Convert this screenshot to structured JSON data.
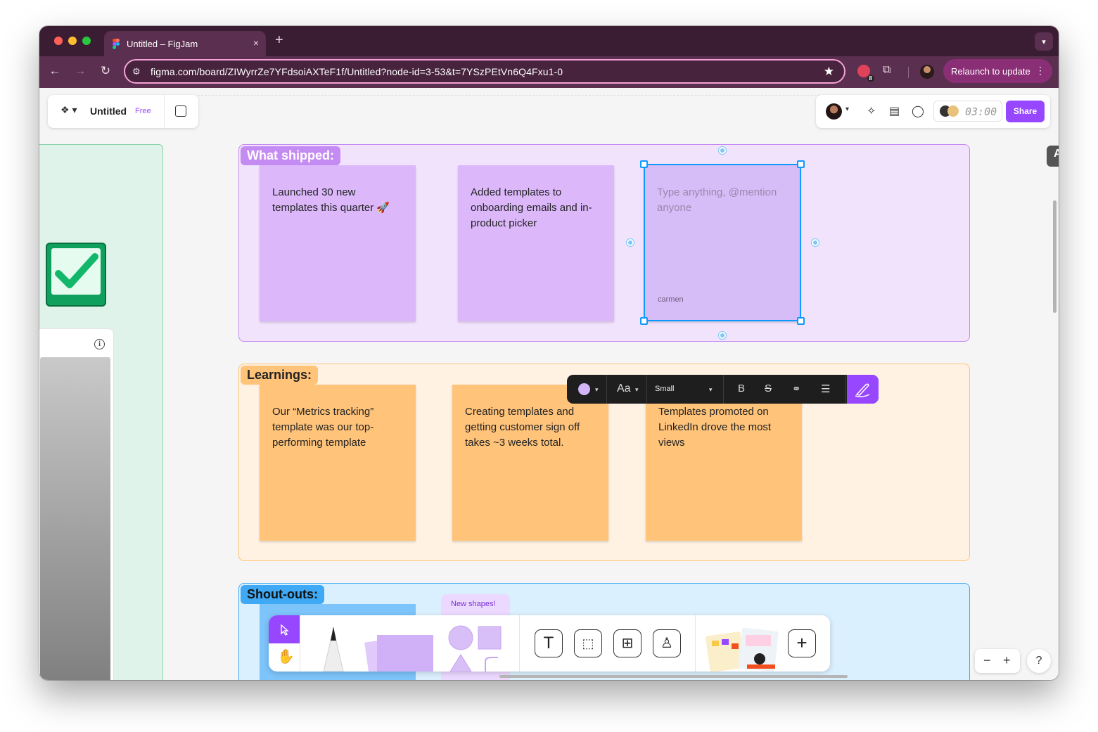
{
  "browser": {
    "tab_title": "Untitled – FigJam",
    "url": "figma.com/board/ZIWyrrZe7YFdsoiAXTeF1f/Untitled?node-id=3-53&t=7YSzPEtVn6Q4Fxu1-0",
    "extension_badge": "8",
    "relaunch_label": "Relaunch to update",
    "new_tab": "+",
    "close_tab": "×"
  },
  "file": {
    "name": "Untitled",
    "plan_badge": "Free"
  },
  "header": {
    "timer": "03:00",
    "share_label": "Share"
  },
  "sections": [
    {
      "label": "What shipped:",
      "notes": [
        {
          "text": "Launched 30 new templates this quarter 🚀"
        },
        {
          "text": "Added templates to onboarding emails and in-product picker"
        }
      ],
      "selected_note": {
        "placeholder": "Type anything, @mention anyone",
        "author": "carmen"
      }
    },
    {
      "label": "Learnings:",
      "notes": [
        {
          "text": "Our “Metrics tracking” template was our top-performing template"
        },
        {
          "text": "Creating templates and getting customer sign off takes ~3 weeks total."
        },
        {
          "text": "Templates promoted on LinkedIn drove the most views"
        }
      ]
    },
    {
      "label": "Shout-outs:",
      "notes": []
    }
  ],
  "context_toolbar": {
    "font_icon": "Aa",
    "size": "Small",
    "bold": "B",
    "color": "#d3b5f7"
  },
  "toolbar": {
    "new_shapes_label": "New shapes!",
    "text_tool": "T",
    "more": "+"
  },
  "zoom": {
    "minus": "−",
    "plus": "+"
  },
  "help": "?",
  "colors": {
    "purple_section": "#f2e3fd",
    "purple_sticky": "#dcb8fb",
    "orange_section": "#fff2e3",
    "orange_sticky": "#ffc37a",
    "blue_section": "#dbf0fe",
    "accent": "#9747ff",
    "selection": "#0d99ff"
  }
}
